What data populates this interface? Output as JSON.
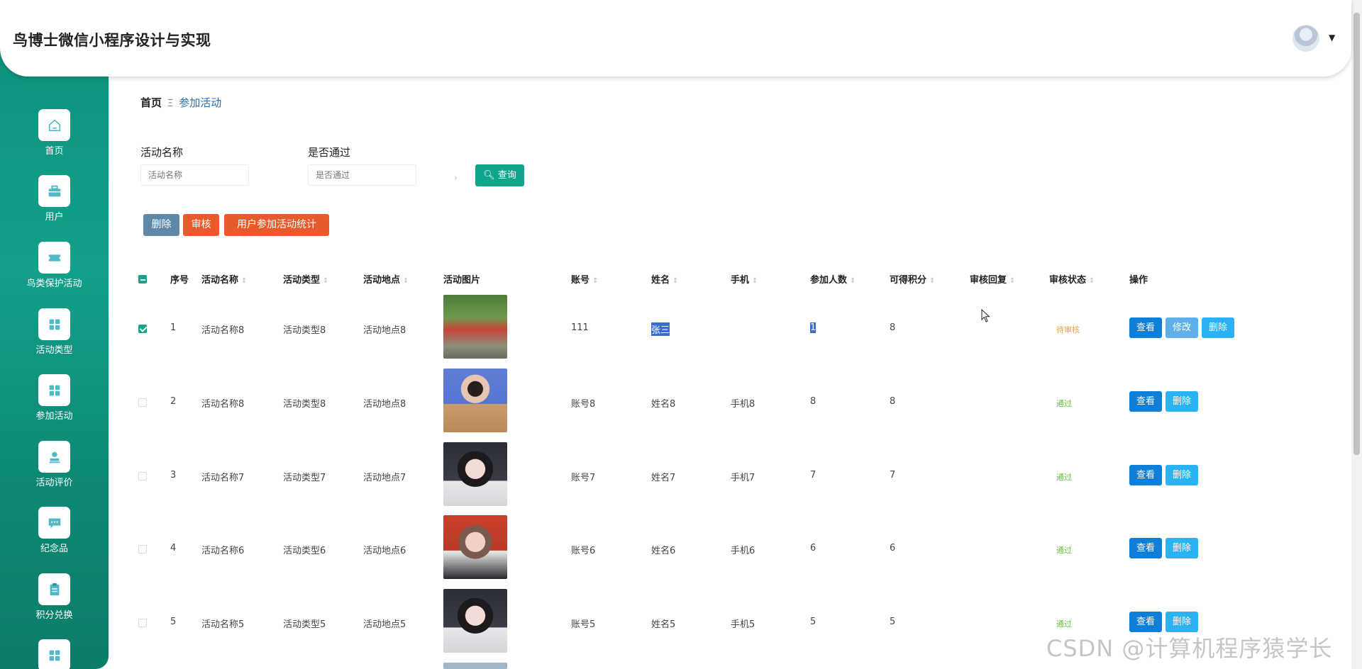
{
  "app": {
    "title": "鸟博士微信小程序设计与实现"
  },
  "header": {
    "avatar_icon": "avatar-image",
    "caret_icon": "caret-down-icon"
  },
  "sidebar": {
    "items": [
      {
        "label": "首页",
        "icon": "home-icon"
      },
      {
        "label": "用户",
        "icon": "briefcase-icon"
      },
      {
        "label": "鸟类保护活动",
        "icon": "ticket-icon"
      },
      {
        "label": "活动类型",
        "icon": "grid-icon"
      },
      {
        "label": "参加活动",
        "icon": "grid-icon"
      },
      {
        "label": "活动评价",
        "icon": "user-icon"
      },
      {
        "label": "纪念品",
        "icon": "chat-icon"
      },
      {
        "label": "积分兑换",
        "icon": "clipboard-icon"
      },
      {
        "label": "",
        "icon": "grid-icon"
      }
    ],
    "colors": {
      "background": "#119a84",
      "active": "#ffffff"
    }
  },
  "breadcrumb": {
    "home": "首页",
    "separator": "Ξ",
    "current": "参加活动"
  },
  "filters": {
    "activity_name": {
      "label": "活动名称",
      "placeholder": "活动名称"
    },
    "is_passed": {
      "label": "是否通过",
      "placeholder": "是否通过",
      "arrow": "›"
    },
    "query_button": "查询"
  },
  "actions": {
    "delete": "删除",
    "audit": "审核",
    "stats": "用户参加活动统计"
  },
  "table": {
    "columns": [
      "序号",
      "活动名称",
      "活动类型",
      "活动地点",
      "活动图片",
      "账号",
      "姓名",
      "手机",
      "参加人数",
      "可得积分",
      "审核回复",
      "审核状态",
      "操作"
    ],
    "rows": [
      {
        "index": "1",
        "name": "活动名称8",
        "type": "活动类型8",
        "place": "活动地点8",
        "account": "111",
        "person": "张三",
        "phone": "",
        "count": "1",
        "points": "8",
        "reply": "",
        "status": "待审核",
        "status_kind": "pending",
        "checked": true,
        "ops": [
          "查看",
          "修改",
          "删除"
        ],
        "image": "group-walk-photo"
      },
      {
        "index": "2",
        "name": "活动名称8",
        "type": "活动类型8",
        "place": "活动地点8",
        "account": "账号8",
        "person": "姓名8",
        "phone": "手机8",
        "count": "8",
        "points": "8",
        "reply": "",
        "status": "通过",
        "status_kind": "pass",
        "checked": false,
        "ops": [
          "查看",
          "删除"
        ],
        "image": "portrait-blue-background"
      },
      {
        "index": "3",
        "name": "活动名称7",
        "type": "活动类型7",
        "place": "活动地点7",
        "account": "账号7",
        "person": "姓名7",
        "phone": "手机7",
        "count": "7",
        "points": "7",
        "reply": "",
        "status": "通过",
        "status_kind": "pass",
        "checked": false,
        "ops": [
          "查看",
          "删除"
        ],
        "image": "portrait-car-interior"
      },
      {
        "index": "4",
        "name": "活动名称6",
        "type": "活动类型6",
        "place": "活动地点6",
        "account": "账号6",
        "person": "姓名6",
        "phone": "手机6",
        "count": "6",
        "points": "6",
        "reply": "",
        "status": "通过",
        "status_kind": "pass",
        "checked": false,
        "ops": [
          "查看",
          "删除"
        ],
        "image": "portrait-red-background"
      },
      {
        "index": "5",
        "name": "活动名称5",
        "type": "活动类型5",
        "place": "活动地点5",
        "account": "账号5",
        "person": "姓名5",
        "phone": "手机5",
        "count": "5",
        "points": "5",
        "reply": "",
        "status": "通过",
        "status_kind": "pass",
        "checked": false,
        "ops": [
          "查看",
          "删除"
        ],
        "image": "portrait-car-interior"
      }
    ]
  },
  "watermark": "CSDN @计算机程序猿学长"
}
